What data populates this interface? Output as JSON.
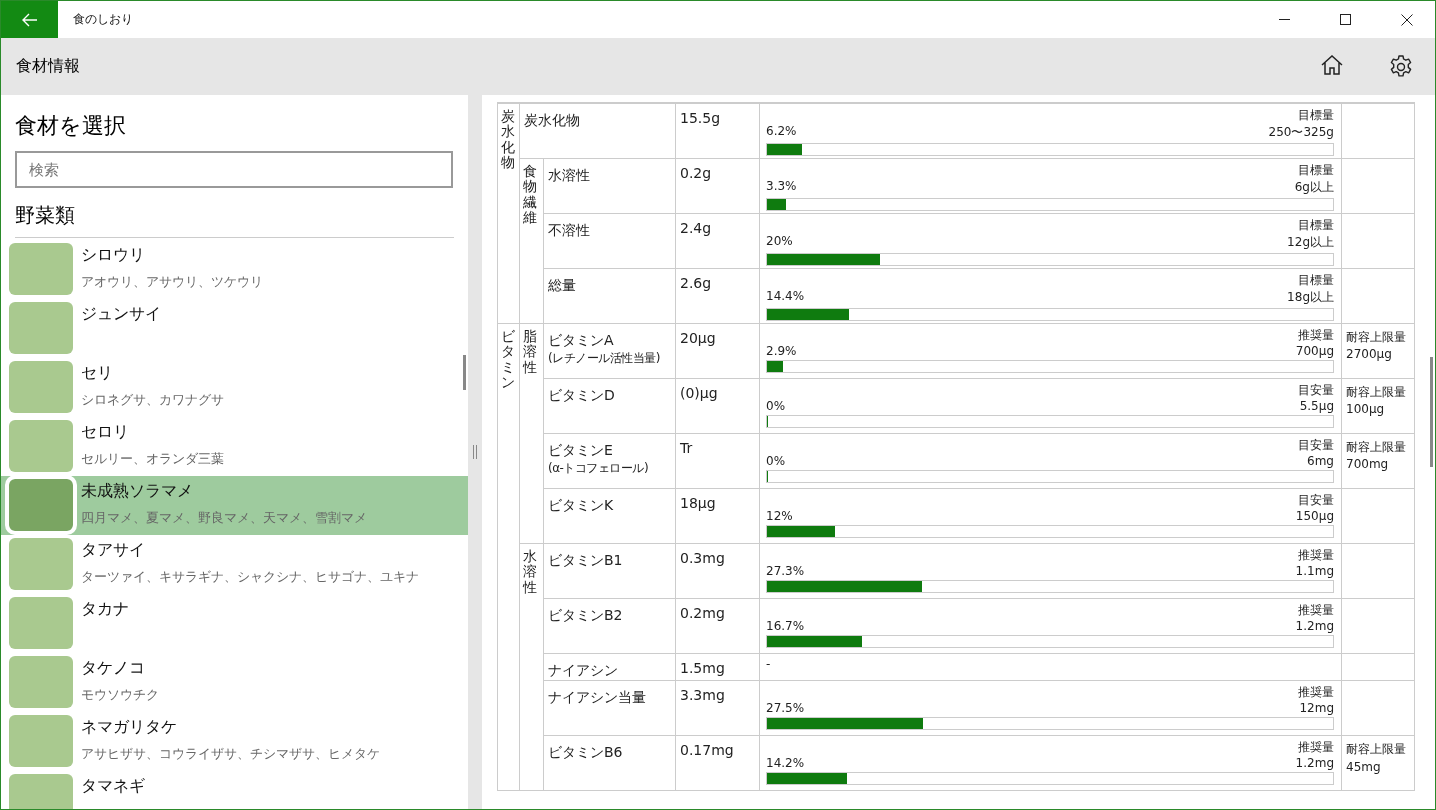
{
  "window": {
    "title": "食のしおり"
  },
  "header": {
    "title": "食材情報"
  },
  "sidebar": {
    "heading": "食材を選択",
    "search": {
      "placeholder": "検索"
    },
    "category": "野菜類",
    "items": [
      {
        "name": "シロウリ",
        "aliases": "アオウリ、アサウリ、ツケウリ",
        "selected": false
      },
      {
        "name": "ジュンサイ",
        "selected": false
      },
      {
        "name": "セリ",
        "aliases": "シロネグサ、カワナグサ",
        "selected": false
      },
      {
        "name": "セロリ",
        "aliases": "セルリー、オランダ三葉",
        "selected": false
      },
      {
        "name": "未成熟ソラマメ",
        "aliases": "四月マメ、夏マメ、野良マメ、天マメ、雪割マメ",
        "selected": true
      },
      {
        "name": "タアサイ",
        "aliases": "ターツァイ、キサラギナ、シャクシナ、ヒサゴナ、ユキナ",
        "selected": false
      },
      {
        "name": "タカナ",
        "selected": false
      },
      {
        "name": "タケノコ",
        "aliases": "モウソウチク",
        "selected": false
      },
      {
        "name": "ネマガリタケ",
        "aliases": "アサヒザサ、コウライザサ、チシマザサ、ヒメタケ",
        "selected": false
      },
      {
        "name": "タマネギ",
        "selected": false
      }
    ]
  },
  "nutrients": {
    "groups": [
      {
        "label": "炭水化物",
        "subgroups": [
          {
            "items": [
              {
                "name": "炭水化物",
                "value": "15.5g",
                "kind": "gauge",
                "percent": "6.2%",
                "level": 0.062,
                "target_label": "目標量",
                "target_value": "250〜325g"
              }
            ]
          },
          {
            "label": "食物繊維",
            "items": [
              {
                "name": "水溶性",
                "value": "0.2g",
                "kind": "gauge",
                "percent": "3.3%",
                "level": 0.033,
                "target_label": "目標量",
                "target_value": "6g以上"
              },
              {
                "name": "不溶性",
                "value": "2.4g",
                "kind": "gauge",
                "percent": "20%",
                "level": 0.2,
                "target_label": "目標量",
                "target_value": "12g以上"
              },
              {
                "name": "総量",
                "value": "2.6g",
                "kind": "gauge",
                "percent": "14.4%",
                "level": 0.144,
                "target_label": "目標量",
                "target_value": "18g以上"
              }
            ]
          }
        ]
      },
      {
        "label": "ビタミン",
        "subgroups": [
          {
            "label": "脂溶性",
            "items": [
              {
                "name": "ビタミンA",
                "name_note": "(レチノール活性当量)",
                "value": "20μg",
                "kind": "gauge",
                "percent": "2.9%",
                "level": 0.029,
                "target_label": "推奨量",
                "target_value": "700μg",
                "upper_label": "耐容上限量",
                "upper_value": "2700μg"
              },
              {
                "name": "ビタミンD",
                "value": "(0)μg",
                "kind": "gauge",
                "percent": "0%",
                "level": 0,
                "target_label": "目安量",
                "target_value": "5.5μg",
                "upper_label": "耐容上限量",
                "upper_value": "100μg"
              },
              {
                "name": "ビタミンE",
                "name_note": "(α-トコフェロール)",
                "value": "Tr",
                "kind": "gauge",
                "percent": "0%",
                "level": 0,
                "target_label": "目安量",
                "target_value": "6mg",
                "upper_label": "耐容上限量",
                "upper_value": "700mg"
              },
              {
                "name": "ビタミンK",
                "value": "18μg",
                "kind": "gauge",
                "percent": "12%",
                "level": 0.12,
                "target_label": "目安量",
                "target_value": "150μg"
              }
            ]
          },
          {
            "label": "水溶性",
            "items": [
              {
                "name": "ビタミンB1",
                "value": "0.3mg",
                "kind": "gauge",
                "percent": "27.3%",
                "level": 0.273,
                "target_label": "推奨量",
                "target_value": "1.1mg"
              },
              {
                "name": "ビタミンB2",
                "value": "0.2mg",
                "kind": "gauge",
                "percent": "16.7%",
                "level": 0.167,
                "target_label": "推奨量",
                "target_value": "1.2mg"
              },
              {
                "name": "ナイアシン",
                "value": "1.5mg",
                "kind": "text",
                "note": "-"
              },
              {
                "name": "ナイアシン当量",
                "value": "3.3mg",
                "kind": "gauge",
                "percent": "27.5%",
                "level": 0.275,
                "target_label": "推奨量",
                "target_value": "12mg"
              },
              {
                "name": "ビタミンB6",
                "value": "0.17mg",
                "kind": "gauge",
                "percent": "14.2%",
                "level": 0.142,
                "target_label": "推奨量",
                "target_value": "1.2mg",
                "upper_label": "耐容上限量",
                "upper_value": "45mg"
              }
            ]
          }
        ]
      }
    ]
  }
}
